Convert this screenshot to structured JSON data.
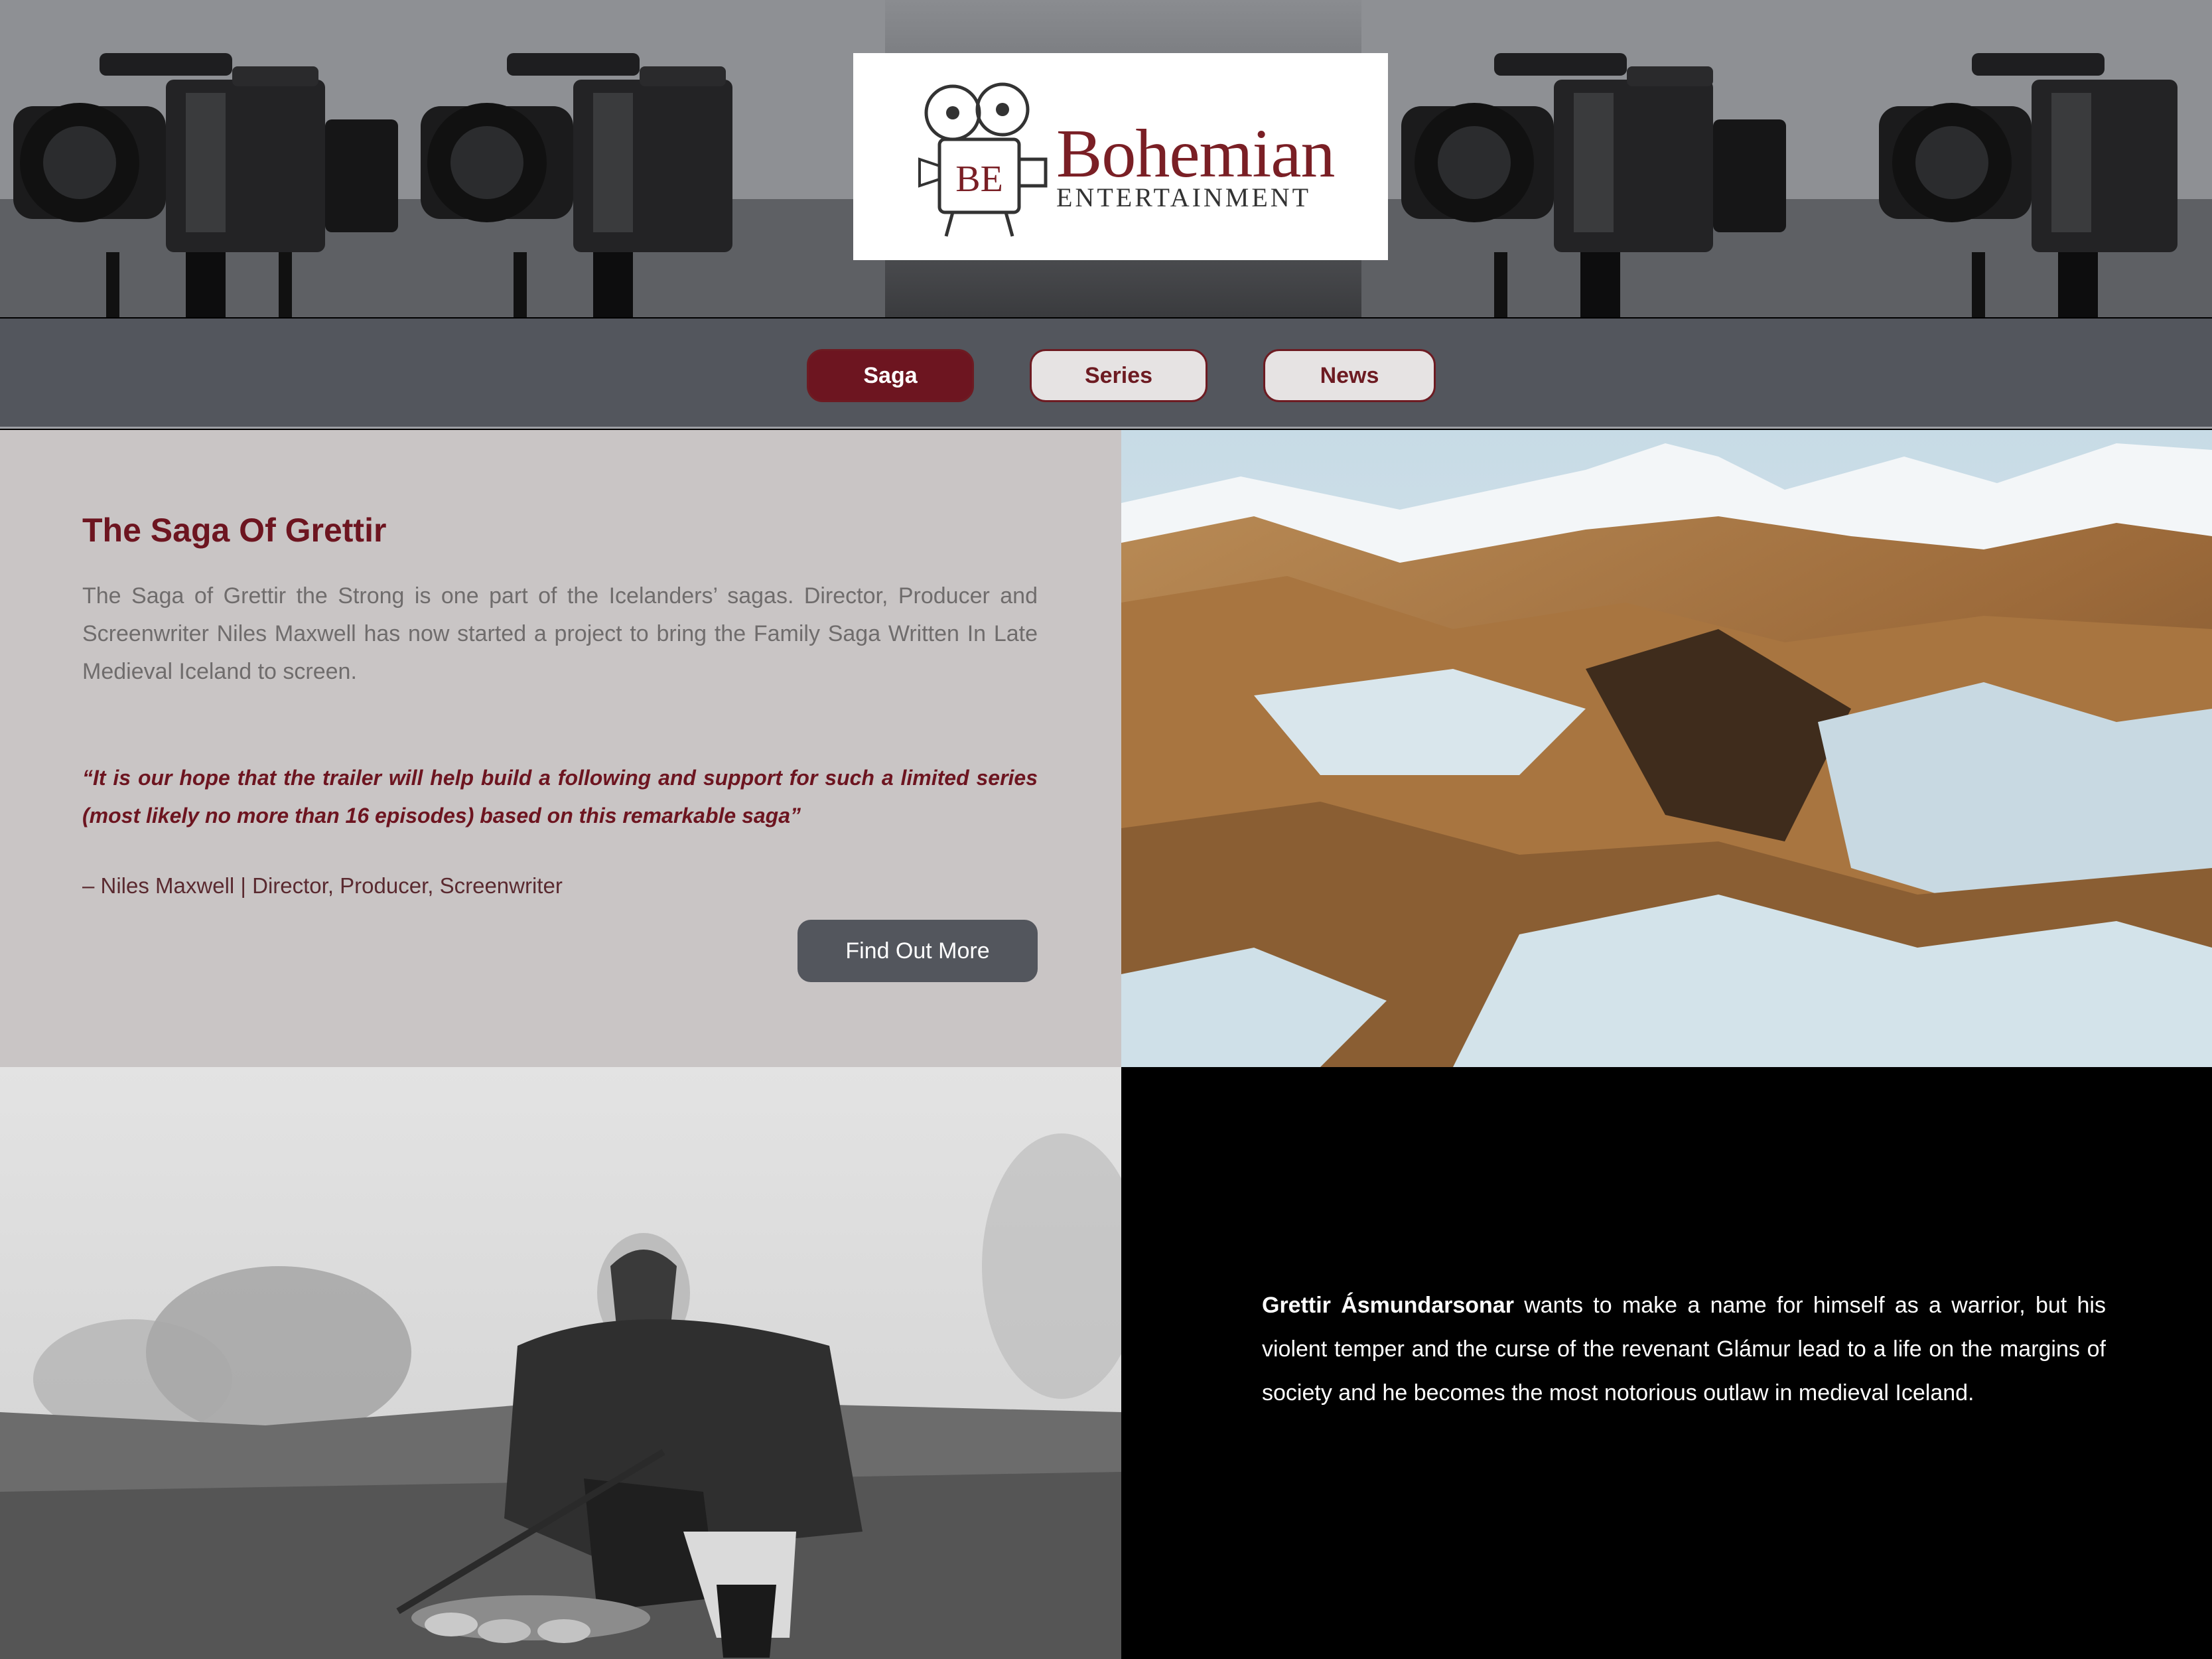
{
  "header": {
    "logo": {
      "wordmark": "Bohemian",
      "subtitle": "ENTERTAINMENT",
      "monogram": "BE"
    },
    "banner_icon": "film-camera-icon"
  },
  "nav": {
    "items": [
      {
        "label": "Saga",
        "active": true
      },
      {
        "label": "Series",
        "active": false
      },
      {
        "label": "News",
        "active": false
      }
    ]
  },
  "saga": {
    "title": "The Saga Of Grettir",
    "description": "The Saga of Grettir the Strong is one part of the Icelanders’ sagas. Director, Producer and Screenwriter Niles Maxwell has now started a project to bring the Family Saga Written In Late Medieval Iceland to screen.",
    "quote": "“It is our hope that the trailer will help build a following and support for such a limited series (most likely no more than 16 episodes) based on this remarkable saga”",
    "attribution": "– Niles Maxwell | Director, Producer, Screenwriter",
    "button_label": "Find Out More"
  },
  "story": {
    "name": "Grettir Ásmundarsonar",
    "text": " wants to make a name for himself as a warrior, but his violent temper and the curse of the revenant Glámur lead to a life on the margins of society and he becomes the most notorious outlaw in medieval Iceland."
  },
  "colors": {
    "brand": "#6d1520",
    "nav_bg": "#53565d",
    "panel_bg": "#c9c5c5",
    "dark_panel": "#000000"
  }
}
